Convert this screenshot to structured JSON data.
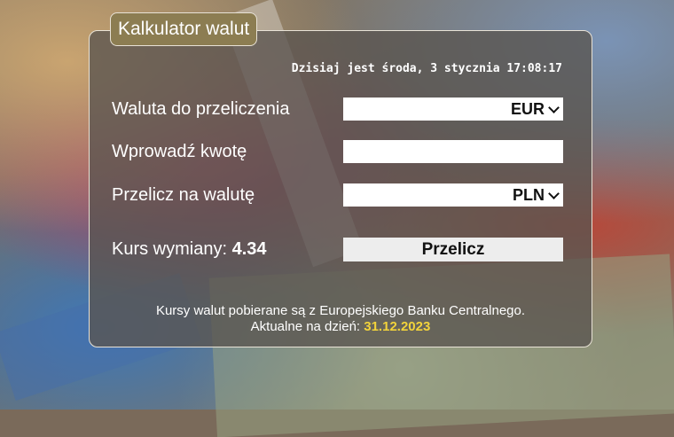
{
  "title": "Kalkulator walut",
  "clock_text": "Dzisiaj jest środa, 3 stycznia 17:08:17",
  "form": {
    "from_label": "Waluta do przeliczenia",
    "from_value": "EUR",
    "amount_label": "Wprowadź kwotę",
    "amount_value": "",
    "amount_placeholder": "",
    "to_label": "Przelicz na walutę",
    "to_value": "PLN"
  },
  "rate": {
    "label": "Kurs wymiany:",
    "value": "4.34"
  },
  "button_label": "Przelicz",
  "footer": {
    "line1": "Kursy walut pobierane są z Europejskiego Banku Centralnego.",
    "line2_prefix": "Aktualne na dzień:",
    "line2_date": "31.12.2023"
  },
  "colors": {
    "title_bg": "#8c7d52",
    "date_highlight": "#f2d33b"
  }
}
